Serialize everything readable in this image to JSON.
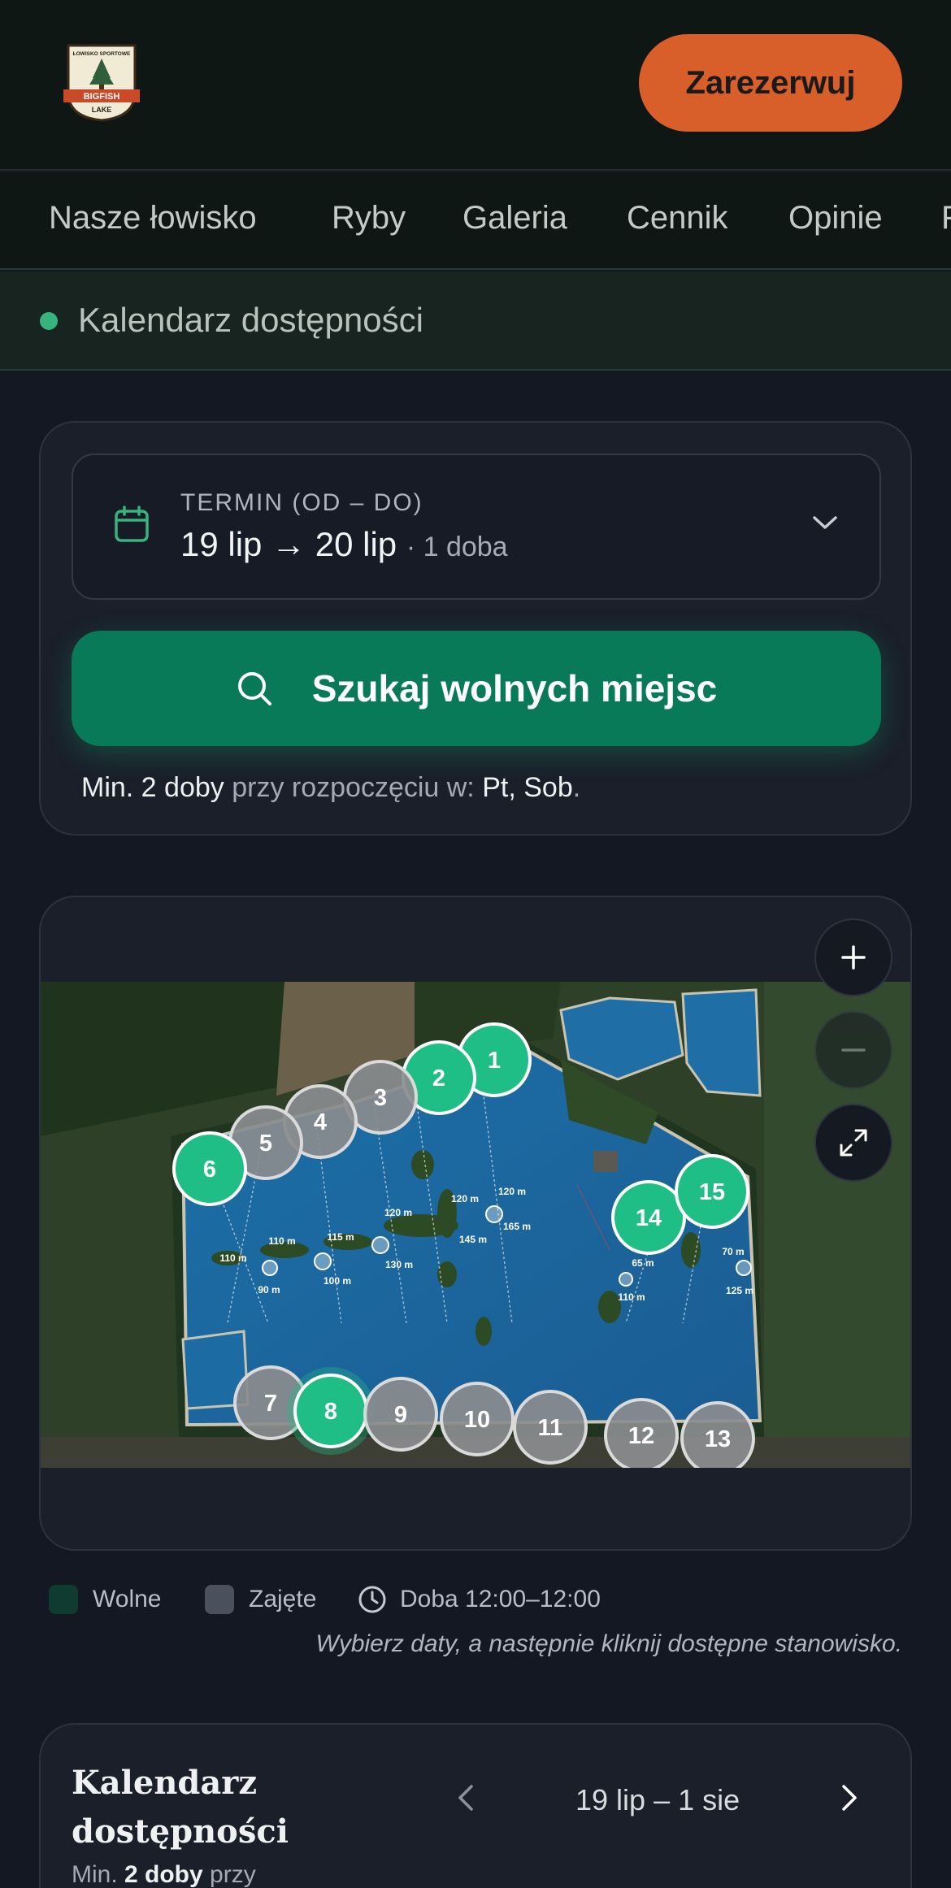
{
  "header": {
    "logo_top_text": "ŁOWISKO SPORTOWE",
    "logo_brand": "BIGFISH",
    "logo_sub": "LAKE",
    "reserve_label": "Zarezerwuj"
  },
  "nav": {
    "items": [
      "Nasze łowisko",
      "Ryby",
      "Galeria",
      "Cennik",
      "Opinie",
      "F"
    ]
  },
  "availability_bar": {
    "label": "Kalendarz dostępności"
  },
  "search": {
    "date_label": "TERMIN (OD – DO)",
    "date_value": "19 lip → 20 lip",
    "date_nights": "· 1 doba",
    "search_label": "Szukaj wolnych miejsc",
    "min_prefix": "Min. 2 doby",
    "min_middle": " przy rozpoczęciu w: ",
    "min_days": "Pt, Sob",
    "min_suffix": "."
  },
  "map": {
    "zoom_in": "+",
    "zoom_out": "−",
    "icons": [
      "plus-icon",
      "minus-icon",
      "expand-icon"
    ],
    "pegs": [
      {
        "num": "1",
        "status": "free"
      },
      {
        "num": "2",
        "status": "free"
      },
      {
        "num": "3",
        "status": "taken"
      },
      {
        "num": "4",
        "status": "taken"
      },
      {
        "num": "5",
        "status": "taken"
      },
      {
        "num": "6",
        "status": "free"
      },
      {
        "num": "7",
        "status": "taken"
      },
      {
        "num": "8",
        "status": "free"
      },
      {
        "num": "9",
        "status": "taken"
      },
      {
        "num": "10",
        "status": "taken"
      },
      {
        "num": "11",
        "status": "taken"
      },
      {
        "num": "12",
        "status": "taken"
      },
      {
        "num": "13",
        "status": "taken"
      },
      {
        "num": "14",
        "status": "free"
      },
      {
        "num": "15",
        "status": "free"
      }
    ],
    "distances": [
      "110 m",
      "110 m",
      "90 m",
      "115 m",
      "100 m",
      "120 m",
      "130 m",
      "120 m",
      "120 m",
      "145 m",
      "165 m",
      "65 m",
      "110 m",
      "70 m",
      "125 m"
    ],
    "colors": {
      "free": "#1fbe86",
      "taken": "#8a8c8e",
      "water": "#1f78b4"
    }
  },
  "legend": {
    "free": "Wolne",
    "taken": "Zajęte",
    "day": "Doba 12:00–12:00",
    "free_color": "#0f3b30",
    "taken_color": "#4a505c"
  },
  "hint": "Wybierz daty, a następnie kliknij dostępne stanowisko.",
  "calendar": {
    "title": "Kalendarz dostępności",
    "sub_prefix": "Min. ",
    "sub_bold": "2 doby",
    "sub_suffix": " przy",
    "range": "19 lip – 1 sie"
  }
}
